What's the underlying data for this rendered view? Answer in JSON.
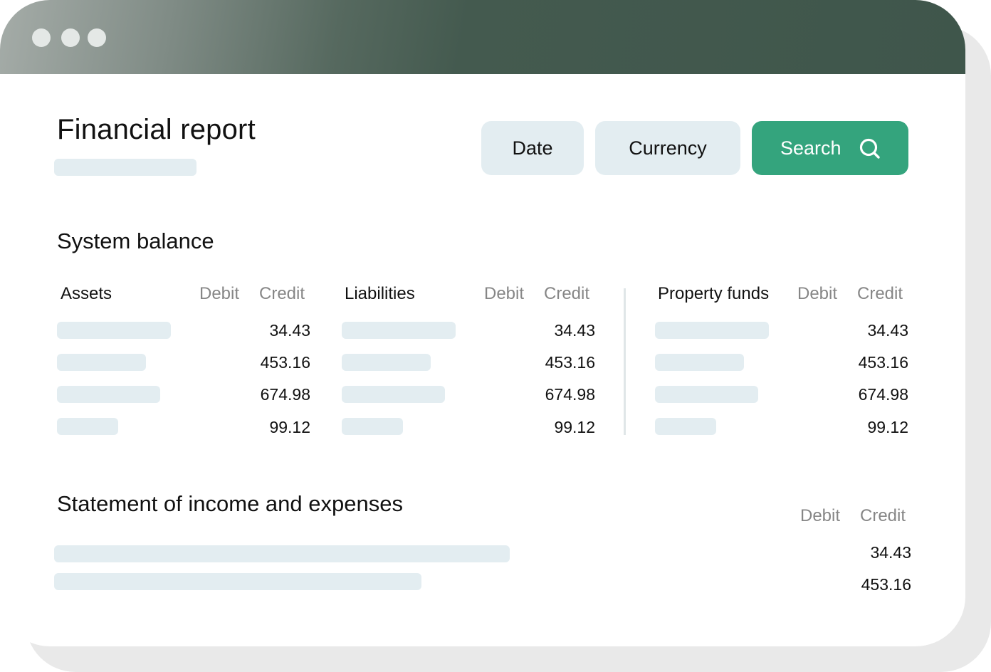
{
  "window": {
    "dots": [
      "dot-1",
      "dot-2",
      "dot-3"
    ]
  },
  "header": {
    "title": "Financial report",
    "filters": {
      "date_label": "Date",
      "currency_label": "Currency",
      "search_label": "Search"
    }
  },
  "system_balance": {
    "title": "System balance",
    "groups": [
      {
        "name": "Assets",
        "debit_label": "Debit",
        "credit_label": "Credit",
        "values": [
          "34.43",
          "453.16",
          "674.98",
          "99.12"
        ]
      },
      {
        "name": "Liabilities",
        "debit_label": "Debit",
        "credit_label": "Credit",
        "values": [
          "34.43",
          "453.16",
          "674.98",
          "99.12"
        ]
      },
      {
        "name": "Property funds",
        "debit_label": "Debit",
        "credit_label": "Credit",
        "values": [
          "34.43",
          "453.16",
          "674.98",
          "99.12"
        ]
      }
    ]
  },
  "income_statement": {
    "title": "Statement of income and expenses",
    "debit_label": "Debit",
    "credit_label": "Credit",
    "values": [
      "34.43",
      "453.16"
    ]
  },
  "colors": {
    "titlebar": "#3f564b",
    "accent": "#34a47d",
    "chip_bg": "#e3edf1",
    "placeholder": "#e3edf1",
    "muted_text": "#868686"
  },
  "icons": {
    "search": "search-icon"
  }
}
